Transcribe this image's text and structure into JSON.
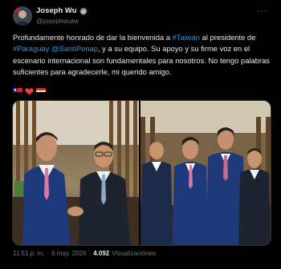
{
  "author": {
    "name": "Joseph Wu",
    "handle": "@josephwutw"
  },
  "menu": {
    "more_label": "···"
  },
  "post": {
    "text_part1": "Profundamente honrado de dar la bienvenida a ",
    "hashtag1": "#Taiwán",
    "text_part2": " al presidente de ",
    "hashtag2": "#Paraguay",
    "mention": "@SantiPenap",
    "text_part3": ", y a su equipo. Su apoyo y su firme voz en el escenario internacional son fundamentales para nosotros. No tengo palabras suficientes para agradecerle, mi querido amigo."
  },
  "emojis": [
    "taiwan-flag",
    "red-heart",
    "paraguay-flag"
  ],
  "media": [
    {
      "icon": "photo-handshake"
    },
    {
      "icon": "photo-group"
    }
  ],
  "meta": {
    "time": "11:51 p. m.",
    "sep1": "·",
    "date": "6 may. 2026",
    "sep2": "·",
    "views": "4.092",
    "views_label": "Visualizaciones"
  },
  "colors": {
    "background": "#000000",
    "link": "#1d9bf0",
    "muted": "#71767b"
  }
}
